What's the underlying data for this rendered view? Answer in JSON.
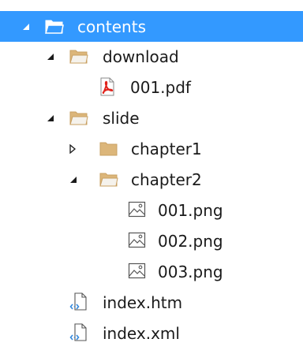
{
  "colors": {
    "selected_background": "#3399ff",
    "selected_text": "#ffffff",
    "folder_fill": "#dcb67a",
    "folder_stroke": "#c9a062",
    "pdf_red": "#e0221b",
    "text": "#1a1a1a"
  },
  "tree": {
    "contents": {
      "label": "contents",
      "icon": "folder-open-icon",
      "expanded": true,
      "selected": true
    },
    "download": {
      "label": "download",
      "icon": "folder-open-icon",
      "expanded": true
    },
    "pdf": {
      "label": "001.pdf",
      "icon": "pdf-file-icon"
    },
    "slide": {
      "label": "slide",
      "icon": "folder-open-icon",
      "expanded": true
    },
    "chapter1": {
      "label": "chapter1",
      "icon": "folder-closed-icon",
      "expanded": false
    },
    "chapter2": {
      "label": "chapter2",
      "icon": "folder-open-icon",
      "expanded": true
    },
    "png1": {
      "label": "001.png",
      "icon": "image-file-icon"
    },
    "png2": {
      "label": "002.png",
      "icon": "image-file-icon"
    },
    "png3": {
      "label": "003.png",
      "icon": "image-file-icon"
    },
    "htm": {
      "label": "index.htm",
      "icon": "web-file-icon"
    },
    "xml": {
      "label": "index.xml",
      "icon": "web-file-icon"
    }
  }
}
